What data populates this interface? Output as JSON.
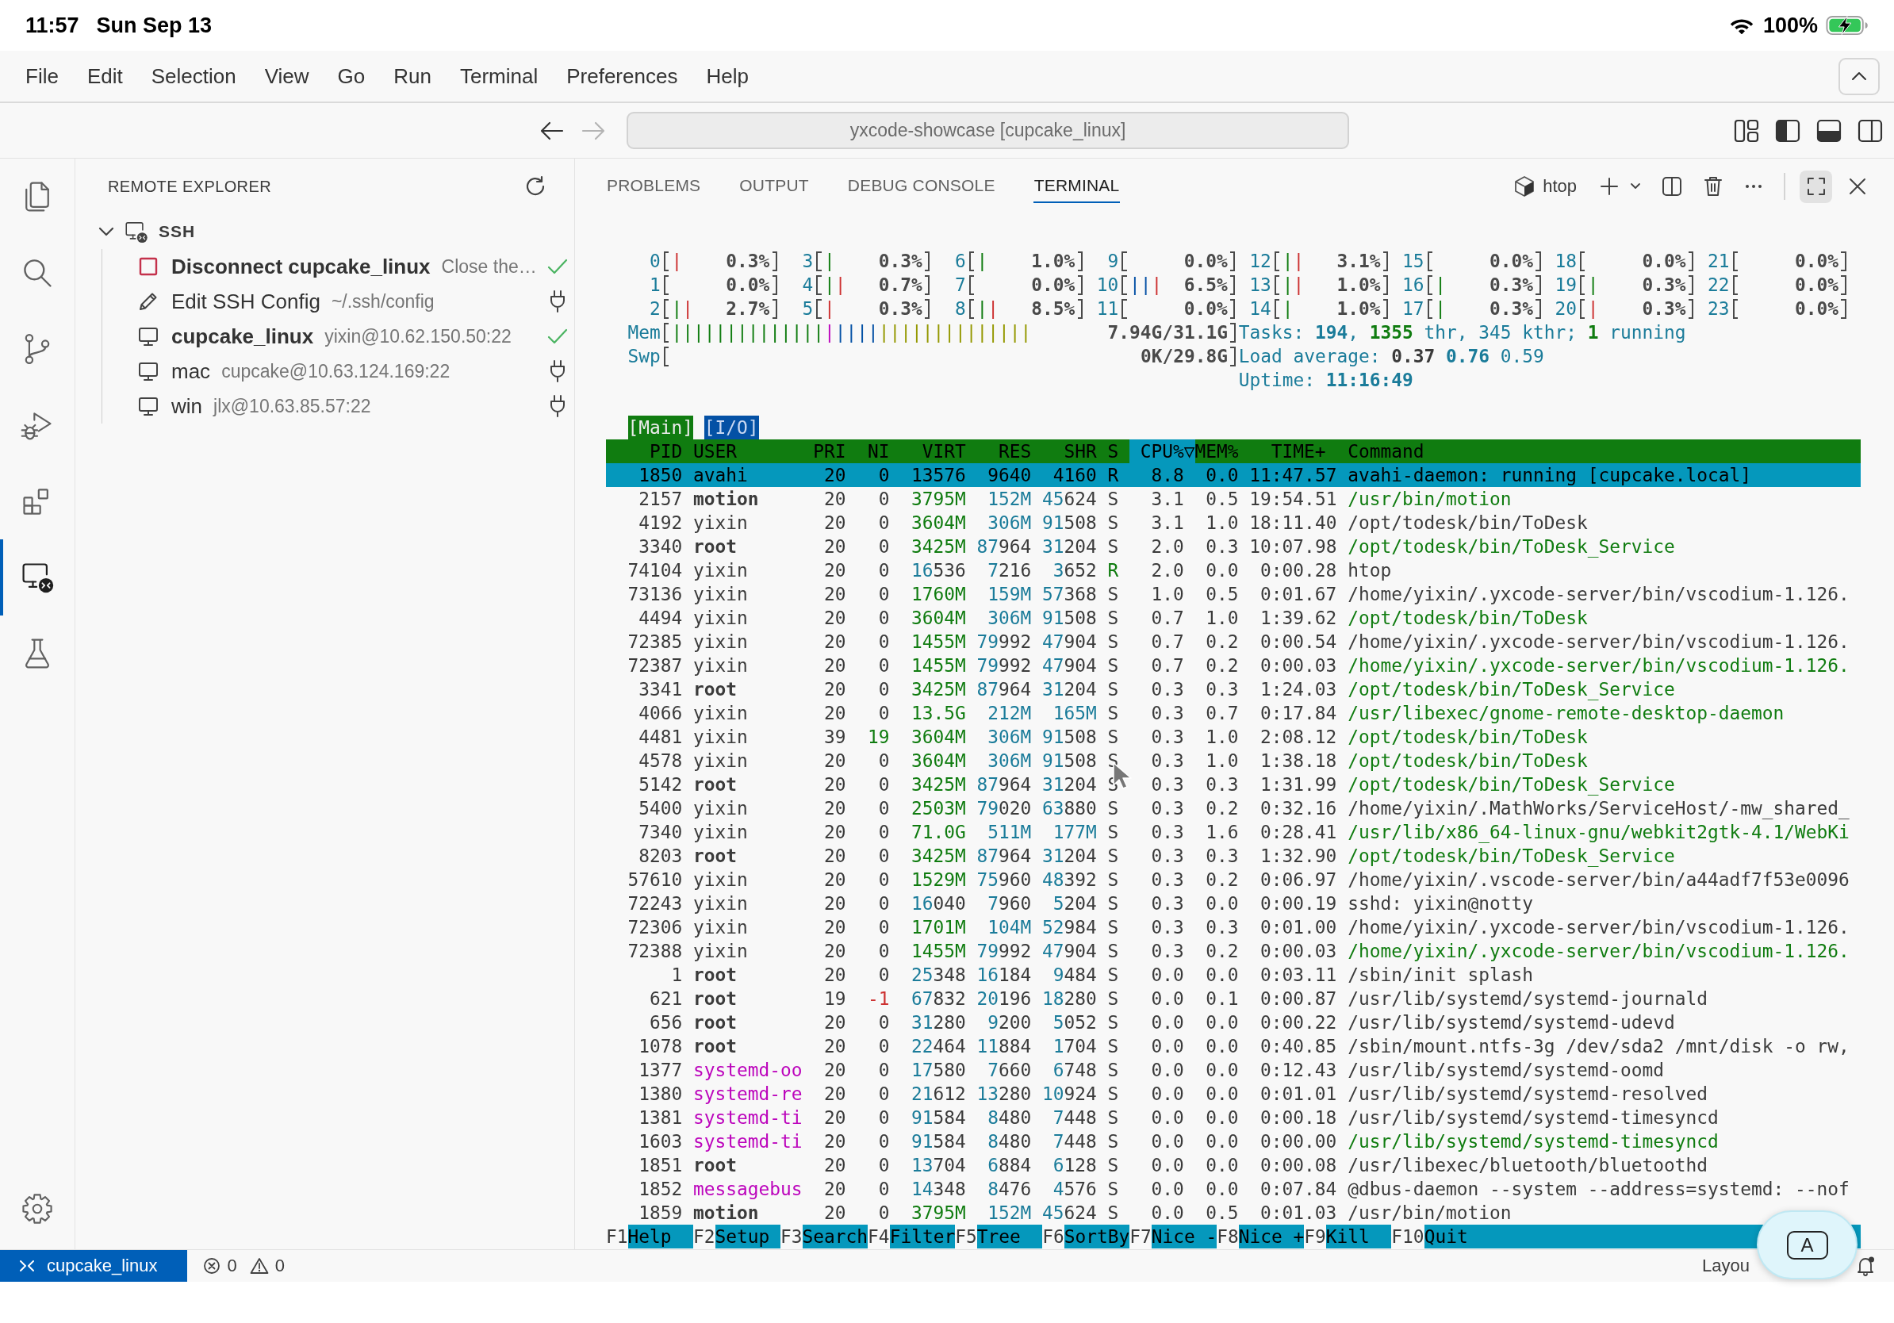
{
  "device_status": {
    "time": "11:57",
    "date": "Sun Sep 13",
    "battery": "100%",
    "charging": true
  },
  "menu_bar": {
    "items": [
      "File",
      "Edit",
      "Selection",
      "View",
      "Go",
      "Run",
      "Terminal",
      "Preferences",
      "Help"
    ]
  },
  "title_bar": {
    "navigation": [
      {
        "kind": "back",
        "disabled": false
      },
      {
        "kind": "forward",
        "disabled": true
      }
    ],
    "command_center": "yxcode-showcase [cupcake_linux]",
    "layout_controls": [
      {
        "kind": "primary_sidebar",
        "on": true
      },
      {
        "kind": "panel",
        "on": true
      },
      {
        "kind": "secondary_sidebar",
        "on": false
      }
    ]
  },
  "activity_bar": {
    "items": [
      {
        "kind": "explorer",
        "selected": false
      },
      {
        "kind": "search",
        "selected": false
      },
      {
        "kind": "source_control",
        "selected": false
      },
      {
        "kind": "run_debug",
        "selected": false
      },
      {
        "kind": "extensions",
        "selected": false
      },
      {
        "kind": "remote_explorer",
        "selected": true
      },
      {
        "kind": "testing",
        "selected": false
      }
    ]
  },
  "sidebar": {
    "title": "REMOTE EXPLORER",
    "tree": [
      {
        "label": "SSH",
        "expanded": true,
        "children": [
          {
            "kind": "disconnect",
            "label": "Disconnect cupcake_linux",
            "description": "Close the…",
            "connected": true
          },
          {
            "kind": "config",
            "label": "Edit SSH Config",
            "description": "~/.ssh/config",
            "connected": false
          },
          {
            "kind": "host",
            "label": "cupcake_linux",
            "description": "yixin@10.62.150.50:22",
            "connected": true
          },
          {
            "kind": "host",
            "label": "mac",
            "description": "cupcake@10.63.124.169:22",
            "connected": false
          },
          {
            "kind": "host",
            "label": "win",
            "description": "jlx@10.63.85.57:22",
            "connected": false
          }
        ]
      }
    ]
  },
  "panel": {
    "tabs": [
      {
        "label": "PROBLEMS",
        "selected": false
      },
      {
        "label": "OUTPUT",
        "selected": false
      },
      {
        "label": "DEBUG CONSOLE",
        "selected": false
      },
      {
        "label": "TERMINAL",
        "selected": true
      }
    ],
    "terminal_name": "htop",
    "maximized": true,
    "htop": {
      "cpu_meters": [
        {
          "label": "0",
          "value": "0.3%",
          "segments": [
            {
              "color": "#cd3131",
              "bars": "|"
            }
          ]
        },
        {
          "label": "1",
          "value": "0.0%"
        },
        {
          "label": "2",
          "value": "2.7%",
          "segments": [
            {
              "color": "#107c10",
              "bars": "|"
            },
            {
              "color": "#cd3131",
              "bars": "|"
            }
          ]
        },
        {
          "label": "3",
          "value": "0.3%",
          "segments": [
            {
              "color": "#107c10",
              "bars": "|"
            }
          ]
        },
        {
          "label": "4",
          "value": "0.7%",
          "segments": [
            {
              "color": "#107c10",
              "bars": "|"
            },
            {
              "color": "#cd3131",
              "bars": "|"
            }
          ]
        },
        {
          "label": "5",
          "value": "0.3%",
          "segments": [
            {
              "color": "#cd3131",
              "bars": "|"
            }
          ]
        },
        {
          "label": "6",
          "value": "1.0%",
          "segments": [
            {
              "color": "#107c10",
              "bars": "|"
            }
          ]
        },
        {
          "label": "7",
          "value": "0.0%"
        },
        {
          "label": "8",
          "value": "8.5%",
          "segments": [
            {
              "color": "#107c10",
              "bars": "|"
            },
            {
              "color": "#cd3131",
              "bars": "|"
            }
          ]
        },
        {
          "label": "9",
          "value": "0.0%"
        },
        {
          "label": "10",
          "value": "6.5%",
          "segments": [
            {
              "color": "#0451a5",
              "bars": "||"
            },
            {
              "color": "#cd3131",
              "bars": "|"
            }
          ]
        },
        {
          "label": "11",
          "value": "0.0%"
        },
        {
          "label": "12",
          "value": "3.1%",
          "segments": [
            {
              "color": "#107c10",
              "bars": "|"
            },
            {
              "color": "#cd3131",
              "bars": "|"
            }
          ]
        },
        {
          "label": "13",
          "value": "1.0%",
          "segments": [
            {
              "color": "#107c10",
              "bars": "|"
            },
            {
              "color": "#cd3131",
              "bars": "|"
            }
          ]
        },
        {
          "label": "14",
          "value": "1.0%",
          "segments": [
            {
              "color": "#107c10",
              "bars": "|"
            }
          ]
        },
        {
          "label": "15",
          "value": "0.0%"
        },
        {
          "label": "16",
          "value": "0.3%",
          "segments": [
            {
              "color": "#107c10",
              "bars": "|"
            }
          ]
        },
        {
          "label": "17",
          "value": "0.3%",
          "segments": [
            {
              "color": "#107c10",
              "bars": "|"
            }
          ]
        },
        {
          "label": "18",
          "value": "0.0%"
        },
        {
          "label": "19",
          "value": "0.3%",
          "segments": [
            {
              "color": "#107c10",
              "bars": "|"
            }
          ]
        },
        {
          "label": "20",
          "value": "0.3%",
          "segments": [
            {
              "color": "#cd3131",
              "bars": "|"
            }
          ]
        },
        {
          "label": "21",
          "value": "0.0%"
        },
        {
          "label": "22",
          "value": "0.0%"
        },
        {
          "label": "23",
          "value": "0.0%"
        }
      ],
      "memory": [
        {
          "label": "Mem",
          "value": "7.94G/31.1G",
          "segments": [
            {
              "color": "#107c10",
              "bars": "||||||||||||||"
            },
            {
              "color": "#bc05bc",
              "bars": "|"
            },
            {
              "color": "#0451a5",
              "bars": "||||"
            },
            {
              "color": "#949800",
              "bars": "||||||||||||||"
            }
          ]
        },
        {
          "label": "Swp",
          "value": "0K/29.8G"
        }
      ],
      "stats": [
        {
          "label": "Tasks:",
          "value": "**194**, **1355** thr, 345 kthr; **1** running"
        },
        {
          "label": "Load average:",
          "value": "**0.37** **0.76** 0.59"
        },
        {
          "label": "Uptime:",
          "value": "**11:16:49**"
        }
      ],
      "tabs": [
        {
          "label": "[Main]",
          "selected": true
        },
        {
          "label": "[I/O]",
          "selected": false
        }
      ],
      "columns": [
        {
          "label": "PID",
          "selected": false
        },
        {
          "label": "USER",
          "selected": false
        },
        {
          "label": "PRI",
          "selected": false
        },
        {
          "label": "NI",
          "selected": false
        },
        {
          "label": "VIRT",
          "selected": false
        },
        {
          "label": "RES",
          "selected": false
        },
        {
          "label": "SHR",
          "selected": false
        },
        {
          "label": "S",
          "selected": false
        },
        {
          "label": "CPU%▽",
          "selected": true
        },
        {
          "label": "MEM%",
          "selected": false
        },
        {
          "label": "TIME+",
          "selected": false
        },
        {
          "label": "Command",
          "selected": false
        }
      ],
      "processes": [
        {
          "pid": "1850",
          "user": "avahi",
          "user_bold": false,
          "user_highlighted": false,
          "pri": "20",
          "ni": "0",
          "low_priority": false,
          "high_priority": false,
          "virt": "13576",
          "res": "9640",
          "shr": "4160",
          "state": "R",
          "running": true,
          "cpu": "8.8",
          "mem": "0.0",
          "time": "11:47.57",
          "command": "avahi-daemon: running [cupcake.local]",
          "thread": false,
          "selected": true
        },
        {
          "pid": "2157",
          "user": "motion",
          "user_bold": true,
          "user_highlighted": false,
          "pri": "20",
          "ni": "0",
          "low_priority": false,
          "high_priority": false,
          "virt": "3795M",
          "res": "152M",
          "shr": "45624",
          "state": "S",
          "running": false,
          "cpu": "3.1",
          "mem": "0.5",
          "time": "19:54.51",
          "command": "/usr/bin/motion",
          "thread": true,
          "selected": false
        },
        {
          "pid": "4192",
          "user": "yixin",
          "user_bold": false,
          "user_highlighted": false,
          "pri": "20",
          "ni": "0",
          "low_priority": false,
          "high_priority": false,
          "virt": "3604M",
          "res": "306M",
          "shr": "91508",
          "state": "S",
          "running": false,
          "cpu": "3.1",
          "mem": "1.0",
          "time": "18:11.40",
          "command": "/opt/todesk/bin/ToDesk",
          "thread": false,
          "selected": false
        },
        {
          "pid": "3340",
          "user": "root",
          "user_bold": true,
          "user_highlighted": false,
          "pri": "20",
          "ni": "0",
          "low_priority": false,
          "high_priority": false,
          "virt": "3425M",
          "res": "87964",
          "shr": "31204",
          "state": "S",
          "running": false,
          "cpu": "2.0",
          "mem": "0.3",
          "time": "10:07.98",
          "command": "/opt/todesk/bin/ToDesk_Service",
          "thread": true,
          "selected": false
        },
        {
          "pid": "74104",
          "user": "yixin",
          "user_bold": false,
          "user_highlighted": false,
          "pri": "20",
          "ni": "0",
          "low_priority": false,
          "high_priority": false,
          "virt": "16536",
          "res": "7216",
          "shr": "3652",
          "state": "R",
          "running": true,
          "cpu": "2.0",
          "mem": "0.0",
          "time": "0:00.28",
          "command": "htop",
          "thread": false,
          "selected": false
        },
        {
          "pid": "73136",
          "user": "yixin",
          "user_bold": false,
          "user_highlighted": false,
          "pri": "20",
          "ni": "0",
          "low_priority": false,
          "high_priority": false,
          "virt": "1760M",
          "res": "159M",
          "shr": "57368",
          "state": "S",
          "running": false,
          "cpu": "1.0",
          "mem": "0.5",
          "time": "0:01.67",
          "command": "/home/yixin/.yxcode-server/bin/vscodium-1.126.",
          "thread": false,
          "selected": false
        },
        {
          "pid": "4494",
          "user": "yixin",
          "user_bold": false,
          "user_highlighted": false,
          "pri": "20",
          "ni": "0",
          "low_priority": false,
          "high_priority": false,
          "virt": "3604M",
          "res": "306M",
          "shr": "91508",
          "state": "S",
          "running": false,
          "cpu": "0.7",
          "mem": "1.0",
          "time": "1:39.62",
          "command": "/opt/todesk/bin/ToDesk",
          "thread": true,
          "selected": false
        },
        {
          "pid": "72385",
          "user": "yixin",
          "user_bold": false,
          "user_highlighted": false,
          "pri": "20",
          "ni": "0",
          "low_priority": false,
          "high_priority": false,
          "virt": "1455M",
          "res": "79992",
          "shr": "47904",
          "state": "S",
          "running": false,
          "cpu": "0.7",
          "mem": "0.2",
          "time": "0:00.54",
          "command": "/home/yixin/.yxcode-server/bin/vscodium-1.126.",
          "thread": false,
          "selected": false
        },
        {
          "pid": "72387",
          "user": "yixin",
          "user_bold": false,
          "user_highlighted": false,
          "pri": "20",
          "ni": "0",
          "low_priority": false,
          "high_priority": false,
          "virt": "1455M",
          "res": "79992",
          "shr": "47904",
          "state": "S",
          "running": false,
          "cpu": "0.7",
          "mem": "0.2",
          "time": "0:00.03",
          "command": "/home/yixin/.yxcode-server/bin/vscodium-1.126.",
          "thread": true,
          "selected": false
        },
        {
          "pid": "3341",
          "user": "root",
          "user_bold": true,
          "user_highlighted": false,
          "pri": "20",
          "ni": "0",
          "low_priority": false,
          "high_priority": false,
          "virt": "3425M",
          "res": "87964",
          "shr": "31204",
          "state": "S",
          "running": false,
          "cpu": "0.3",
          "mem": "0.3",
          "time": "1:24.03",
          "command": "/opt/todesk/bin/ToDesk_Service",
          "thread": true,
          "selected": false
        },
        {
          "pid": "4066",
          "user": "yixin",
          "user_bold": false,
          "user_highlighted": false,
          "pri": "20",
          "ni": "0",
          "low_priority": false,
          "high_priority": false,
          "virt": "13.5G",
          "res": "212M",
          "shr": "165M",
          "state": "S",
          "running": false,
          "cpu": "0.3",
          "mem": "0.7",
          "time": "0:17.84",
          "command": "/usr/libexec/gnome-remote-desktop-daemon",
          "thread": true,
          "selected": false
        },
        {
          "pid": "4481",
          "user": "yixin",
          "user_bold": false,
          "user_highlighted": false,
          "pri": "39",
          "ni": "19",
          "low_priority": true,
          "high_priority": false,
          "virt": "3604M",
          "res": "306M",
          "shr": "91508",
          "state": "S",
          "running": false,
          "cpu": "0.3",
          "mem": "1.0",
          "time": "2:08.12",
          "command": "/opt/todesk/bin/ToDesk",
          "thread": true,
          "selected": false
        },
        {
          "pid": "4578",
          "user": "yixin",
          "user_bold": false,
          "user_highlighted": false,
          "pri": "20",
          "ni": "0",
          "low_priority": false,
          "high_priority": false,
          "virt": "3604M",
          "res": "306M",
          "shr": "91508",
          "state": "S",
          "running": false,
          "cpu": "0.3",
          "mem": "1.0",
          "time": "1:38.18",
          "command": "/opt/todesk/bin/ToDesk",
          "thread": true,
          "selected": false
        },
        {
          "pid": "5142",
          "user": "root",
          "user_bold": true,
          "user_highlighted": false,
          "pri": "20",
          "ni": "0",
          "low_priority": false,
          "high_priority": false,
          "virt": "3425M",
          "res": "87964",
          "shr": "31204",
          "state": "S",
          "running": false,
          "cpu": "0.3",
          "mem": "0.3",
          "time": "1:31.99",
          "command": "/opt/todesk/bin/ToDesk_Service",
          "thread": true,
          "selected": false
        },
        {
          "pid": "5400",
          "user": "yixin",
          "user_bold": false,
          "user_highlighted": false,
          "pri": "20",
          "ni": "0",
          "low_priority": false,
          "high_priority": false,
          "virt": "2503M",
          "res": "79020",
          "shr": "63880",
          "state": "S",
          "running": false,
          "cpu": "0.3",
          "mem": "0.2",
          "time": "0:32.16",
          "command": "/home/yixin/.MathWorks/ServiceHost/-mw_shared_",
          "thread": false,
          "selected": false
        },
        {
          "pid": "7340",
          "user": "yixin",
          "user_bold": false,
          "user_highlighted": false,
          "pri": "20",
          "ni": "0",
          "low_priority": false,
          "high_priority": false,
          "virt": "71.0G",
          "res": "511M",
          "shr": "177M",
          "state": "S",
          "running": false,
          "cpu": "0.3",
          "mem": "1.6",
          "time": "0:28.41",
          "command": "/usr/lib/x86_64-linux-gnu/webkit2gtk-4.1/WebKi",
          "thread": true,
          "selected": false
        },
        {
          "pid": "8203",
          "user": "root",
          "user_bold": true,
          "user_highlighted": false,
          "pri": "20",
          "ni": "0",
          "low_priority": false,
          "high_priority": false,
          "virt": "3425M",
          "res": "87964",
          "shr": "31204",
          "state": "S",
          "running": false,
          "cpu": "0.3",
          "mem": "0.3",
          "time": "1:32.90",
          "command": "/opt/todesk/bin/ToDesk_Service",
          "thread": true,
          "selected": false
        },
        {
          "pid": "57610",
          "user": "yixin",
          "user_bold": false,
          "user_highlighted": false,
          "pri": "20",
          "ni": "0",
          "low_priority": false,
          "high_priority": false,
          "virt": "1529M",
          "res": "75960",
          "shr": "48392",
          "state": "S",
          "running": false,
          "cpu": "0.3",
          "mem": "0.2",
          "time": "0:06.97",
          "command": "/home/yixin/.vscode-server/bin/a44adf7f53e0096",
          "thread": false,
          "selected": false
        },
        {
          "pid": "72243",
          "user": "yixin",
          "user_bold": false,
          "user_highlighted": false,
          "pri": "20",
          "ni": "0",
          "low_priority": false,
          "high_priority": false,
          "virt": "16040",
          "res": "7960",
          "shr": "5204",
          "state": "S",
          "running": false,
          "cpu": "0.3",
          "mem": "0.0",
          "time": "0:00.19",
          "command": "sshd: yixin@notty",
          "thread": false,
          "selected": false
        },
        {
          "pid": "72306",
          "user": "yixin",
          "user_bold": false,
          "user_highlighted": false,
          "pri": "20",
          "ni": "0",
          "low_priority": false,
          "high_priority": false,
          "virt": "1701M",
          "res": "104M",
          "shr": "52984",
          "state": "S",
          "running": false,
          "cpu": "0.3",
          "mem": "0.3",
          "time": "0:01.00",
          "command": "/home/yixin/.yxcode-server/bin/vscodium-1.126.",
          "thread": false,
          "selected": false
        },
        {
          "pid": "72388",
          "user": "yixin",
          "user_bold": false,
          "user_highlighted": false,
          "pri": "20",
          "ni": "0",
          "low_priority": false,
          "high_priority": false,
          "virt": "1455M",
          "res": "79992",
          "shr": "47904",
          "state": "S",
          "running": false,
          "cpu": "0.3",
          "mem": "0.2",
          "time": "0:00.03",
          "command": "/home/yixin/.yxcode-server/bin/vscodium-1.126.",
          "thread": true,
          "selected": false
        },
        {
          "pid": "1",
          "user": "root",
          "user_bold": true,
          "user_highlighted": false,
          "pri": "20",
          "ni": "0",
          "low_priority": false,
          "high_priority": false,
          "virt": "25348",
          "res": "16184",
          "shr": "9484",
          "state": "S",
          "running": false,
          "cpu": "0.0",
          "mem": "0.0",
          "time": "0:03.11",
          "command": "/sbin/init splash",
          "thread": false,
          "selected": false
        },
        {
          "pid": "621",
          "user": "root",
          "user_bold": true,
          "user_highlighted": false,
          "pri": "19",
          "ni": "-1",
          "low_priority": false,
          "high_priority": true,
          "virt": "67832",
          "res": "20196",
          "shr": "18280",
          "state": "S",
          "running": false,
          "cpu": "0.0",
          "mem": "0.1",
          "time": "0:00.87",
          "command": "/usr/lib/systemd/systemd-journald",
          "thread": false,
          "selected": false
        },
        {
          "pid": "656",
          "user": "root",
          "user_bold": true,
          "user_highlighted": false,
          "pri": "20",
          "ni": "0",
          "low_priority": false,
          "high_priority": false,
          "virt": "31280",
          "res": "9200",
          "shr": "5052",
          "state": "S",
          "running": false,
          "cpu": "0.0",
          "mem": "0.0",
          "time": "0:00.22",
          "command": "/usr/lib/systemd/systemd-udevd",
          "thread": false,
          "selected": false
        },
        {
          "pid": "1078",
          "user": "root",
          "user_bold": true,
          "user_highlighted": false,
          "pri": "20",
          "ni": "0",
          "low_priority": false,
          "high_priority": false,
          "virt": "22464",
          "res": "11884",
          "shr": "1704",
          "state": "S",
          "running": false,
          "cpu": "0.0",
          "mem": "0.0",
          "time": "0:40.85",
          "command": "/sbin/mount.ntfs-3g /dev/sda2 /mnt/disk -o rw,",
          "thread": false,
          "selected": false
        },
        {
          "pid": "1377",
          "user": "systemd-oo",
          "user_bold": false,
          "user_highlighted": true,
          "pri": "20",
          "ni": "0",
          "low_priority": false,
          "high_priority": false,
          "virt": "17580",
          "res": "7660",
          "shr": "6748",
          "state": "S",
          "running": false,
          "cpu": "0.0",
          "mem": "0.0",
          "time": "0:12.43",
          "command": "/usr/lib/systemd/systemd-oomd",
          "thread": false,
          "selected": false
        },
        {
          "pid": "1380",
          "user": "systemd-re",
          "user_bold": false,
          "user_highlighted": true,
          "pri": "20",
          "ni": "0",
          "low_priority": false,
          "high_priority": false,
          "virt": "21612",
          "res": "13280",
          "shr": "10924",
          "state": "S",
          "running": false,
          "cpu": "0.0",
          "mem": "0.0",
          "time": "0:01.01",
          "command": "/usr/lib/systemd/systemd-resolved",
          "thread": false,
          "selected": false
        },
        {
          "pid": "1381",
          "user": "systemd-ti",
          "user_bold": false,
          "user_highlighted": true,
          "pri": "20",
          "ni": "0",
          "low_priority": false,
          "high_priority": false,
          "virt": "91584",
          "res": "8480",
          "shr": "7448",
          "state": "S",
          "running": false,
          "cpu": "0.0",
          "mem": "0.0",
          "time": "0:00.18",
          "command": "/usr/lib/systemd/systemd-timesyncd",
          "thread": false,
          "selected": false
        },
        {
          "pid": "1603",
          "user": "systemd-ti",
          "user_bold": false,
          "user_highlighted": true,
          "pri": "20",
          "ni": "0",
          "low_priority": false,
          "high_priority": false,
          "virt": "91584",
          "res": "8480",
          "shr": "7448",
          "state": "S",
          "running": false,
          "cpu": "0.0",
          "mem": "0.0",
          "time": "0:00.00",
          "command": "/usr/lib/systemd/systemd-timesyncd",
          "thread": true,
          "selected": false
        },
        {
          "pid": "1851",
          "user": "root",
          "user_bold": true,
          "user_highlighted": false,
          "pri": "20",
          "ni": "0",
          "low_priority": false,
          "high_priority": false,
          "virt": "13704",
          "res": "6884",
          "shr": "6128",
          "state": "S",
          "running": false,
          "cpu": "0.0",
          "mem": "0.0",
          "time": "0:00.08",
          "command": "/usr/libexec/bluetooth/bluetoothd",
          "thread": false,
          "selected": false
        },
        {
          "pid": "1852",
          "user": "messagebus",
          "user_bold": false,
          "user_highlighted": true,
          "pri": "20",
          "ni": "0",
          "low_priority": false,
          "high_priority": false,
          "virt": "14348",
          "res": "8476",
          "shr": "4576",
          "state": "S",
          "running": false,
          "cpu": "0.0",
          "mem": "0.0",
          "time": "0:07.84",
          "command": "@dbus-daemon --system --address=systemd: --nof",
          "thread": false,
          "selected": false
        },
        {
          "pid": "1859",
          "user": "motion",
          "user_bold": true,
          "user_highlighted": false,
          "pri": "20",
          "ni": "0",
          "low_priority": false,
          "high_priority": false,
          "virt": "3795M",
          "res": "152M",
          "shr": "45624",
          "state": "S",
          "running": false,
          "cpu": "0.0",
          "mem": "0.5",
          "time": "0:01.03",
          "command": "/usr/bin/motion",
          "thread": false,
          "selected": false
        }
      ],
      "function_keys": [
        {
          "key": "F1",
          "label": "Help"
        },
        {
          "key": "F2",
          "label": "Setup"
        },
        {
          "key": "F3",
          "label": "Search"
        },
        {
          "key": "F4",
          "label": "Filter"
        },
        {
          "key": "F5",
          "label": "Tree"
        },
        {
          "key": "F6",
          "label": "SortBy"
        },
        {
          "key": "F7",
          "label": "Nice -"
        },
        {
          "key": "F8",
          "label": "Nice +"
        },
        {
          "key": "F9",
          "label": "Kill"
        },
        {
          "key": "F10",
          "label": "Quit"
        }
      ]
    }
  },
  "status_bar": {
    "remote": "cupcake_linux",
    "errors": "0",
    "warnings": "0",
    "right_text": "Layou",
    "notifications_dot": true
  },
  "floating_button": {
    "label": "A"
  }
}
